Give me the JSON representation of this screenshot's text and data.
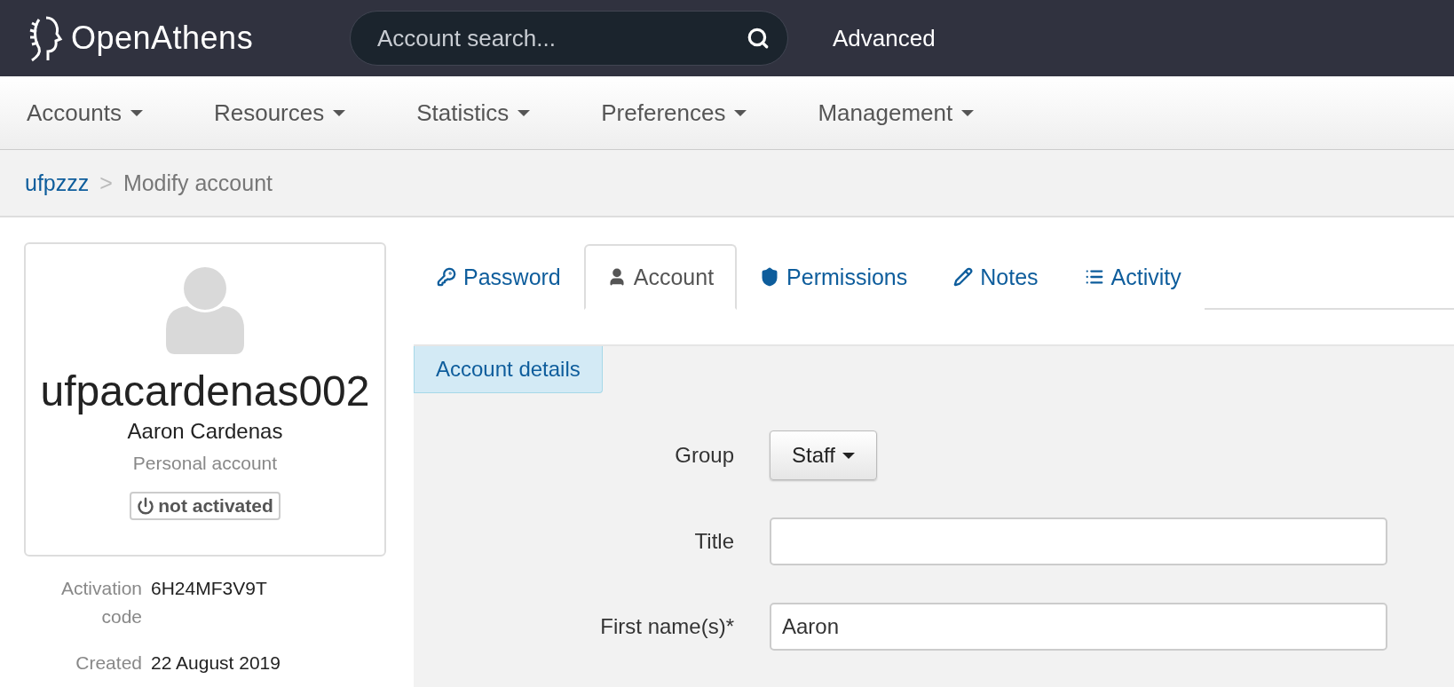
{
  "header": {
    "logo": "OpenAthens",
    "search": {
      "placeholder": "Account search..."
    },
    "advanced_link": "Advanced"
  },
  "nav": [
    {
      "label": "Accounts"
    },
    {
      "label": "Resources"
    },
    {
      "label": "Statistics"
    },
    {
      "label": "Preferences"
    },
    {
      "label": "Management"
    }
  ],
  "breadcrumb": {
    "parent": "ufpzzz",
    "separator": ">",
    "current": "Modify account"
  },
  "profile": {
    "username": "ufpacardenas002",
    "full_name": "Aaron Cardenas",
    "account_type": "Personal account",
    "status": "not activated"
  },
  "details": [
    {
      "label": "Activation code",
      "value": "6H24MF3V9T"
    },
    {
      "label": "Created",
      "value": "22 August 2019"
    }
  ],
  "tabs": [
    {
      "kind": "key",
      "label": "Password",
      "selected": false
    },
    {
      "kind": "user",
      "label": "Account",
      "selected": true
    },
    {
      "kind": "shield",
      "label": "Permissions",
      "selected": false
    },
    {
      "kind": "pencil",
      "label": "Notes",
      "selected": false
    },
    {
      "kind": "list",
      "label": "Activity",
      "selected": false
    }
  ],
  "section": {
    "title": "Account details"
  },
  "form": [
    {
      "kind": "dropdown",
      "label": "Group",
      "value": "Staff"
    },
    {
      "kind": "text",
      "label": "Title"
    },
    {
      "kind": "text",
      "label": "First name(s)*",
      "value": "Aaron"
    }
  ]
}
